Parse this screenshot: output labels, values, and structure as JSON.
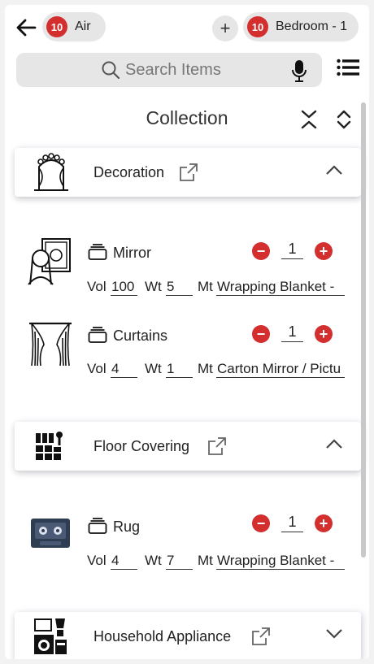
{
  "header": {
    "mode_chip": {
      "count": "10",
      "label": "Air"
    },
    "room_chip": {
      "count": "10",
      "label": "Bedroom - 1"
    },
    "add_label": "+"
  },
  "search": {
    "placeholder": "Search Items"
  },
  "collection_title": "Collection",
  "categories": [
    {
      "label": "Decoration",
      "icon": "wedding-arch-icon",
      "expanded": true,
      "items": [
        {
          "name": "Mirror",
          "icon": "mirror-icon",
          "qty": "1",
          "vol_label": "Vol",
          "vol": "100",
          "wt_label": "Wt",
          "wt": "5",
          "mt_label": "Mt",
          "mt": "Wrapping Blanket -"
        },
        {
          "name": "Curtains",
          "icon": "curtains-icon",
          "qty": "1",
          "vol_label": "Vol",
          "vol": "4",
          "wt_label": "Wt",
          "wt": "1",
          "mt_label": "Mt",
          "mt": "Carton Mirror / Pictu"
        }
      ]
    },
    {
      "label": "Floor Covering",
      "icon": "tiles-icon",
      "expanded": true,
      "items": [
        {
          "name": "Rug",
          "icon": "rug-icon",
          "qty": "1",
          "vol_label": "Vol",
          "vol": "4",
          "wt_label": "Wt",
          "wt": "7",
          "mt_label": "Mt",
          "mt": "Wrapping Blanket -"
        }
      ]
    },
    {
      "label": "Household Appliance",
      "icon": "appliances-icon",
      "expanded": false,
      "items": []
    }
  ],
  "colors": {
    "accent_red": "#d32f2f",
    "chip_bg": "#e6e6e6"
  }
}
